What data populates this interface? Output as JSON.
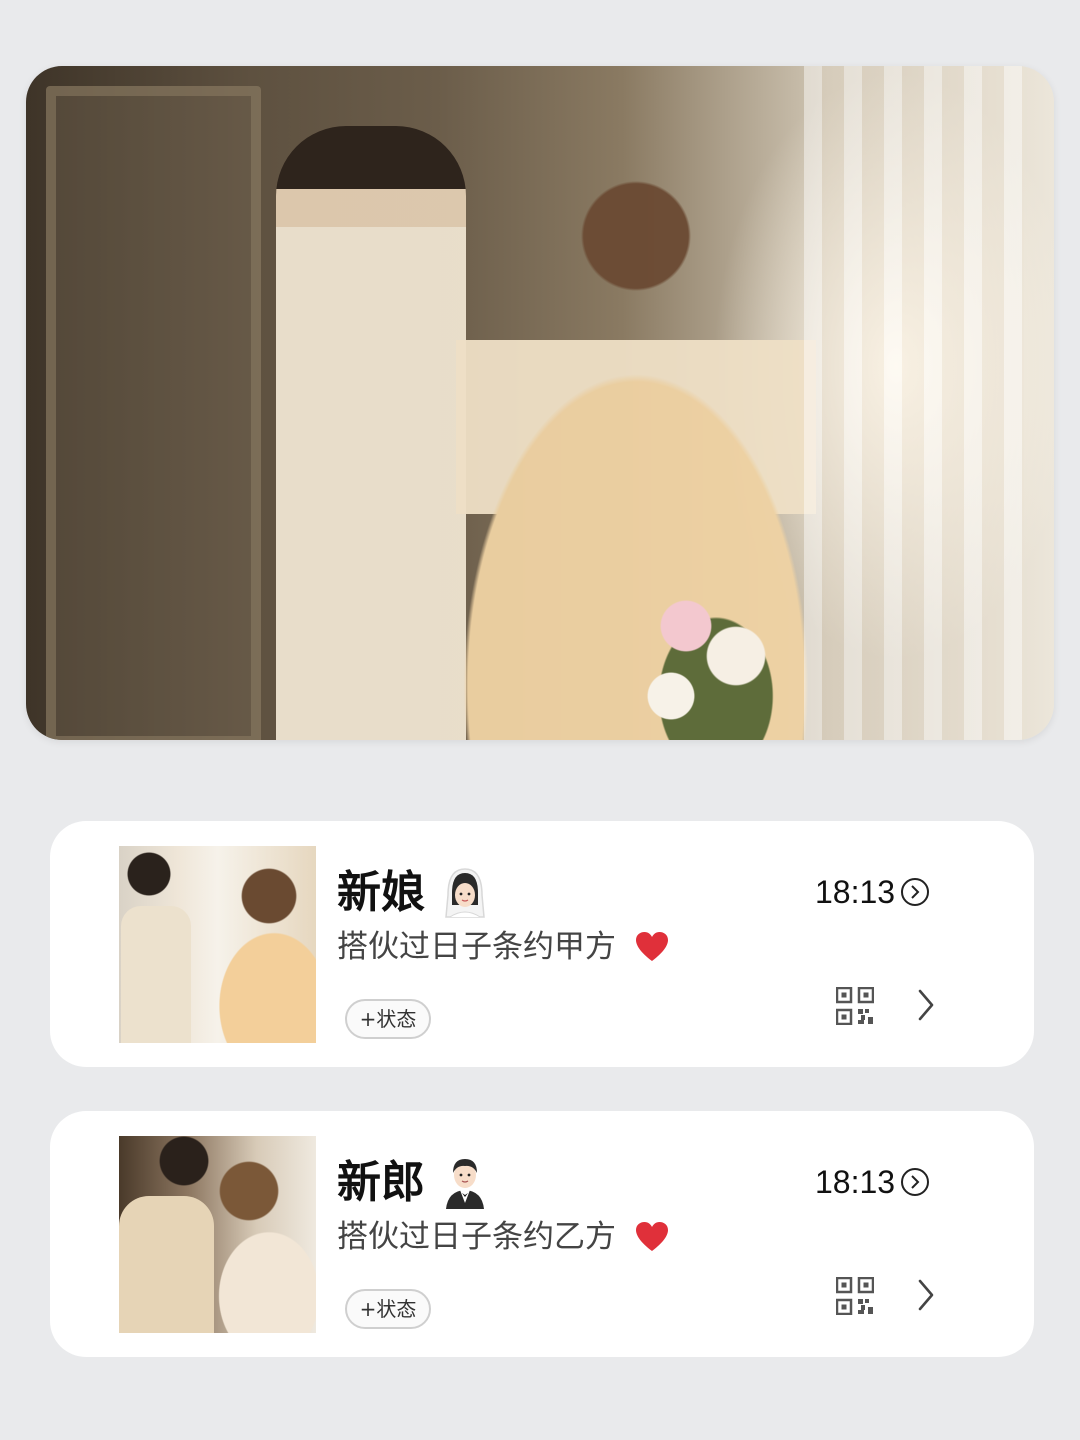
{
  "hero": {
    "image": "wedding-portrait-photo"
  },
  "cards": [
    {
      "name": "新娘",
      "emoji_icon": "bride-emoji-icon",
      "subtitle": "搭伙过日子条约甲方",
      "heart_icon": "red-heart-icon",
      "time": "18:13",
      "status_label": "+状态",
      "avatar": "bride-avatar-photo"
    },
    {
      "name": "新郎",
      "emoji_icon": "groom-emoji-icon",
      "subtitle": "搭伙过日子条约乙方",
      "heart_icon": "red-heart-icon",
      "time": "18:13",
      "status_label": "+状态",
      "avatar": "groom-avatar-photo"
    }
  ],
  "colors": {
    "background": "#e9eaec",
    "card": "#ffffff",
    "heart": "#e0303a",
    "text_primary": "#111111",
    "text_secondary": "#444444"
  }
}
